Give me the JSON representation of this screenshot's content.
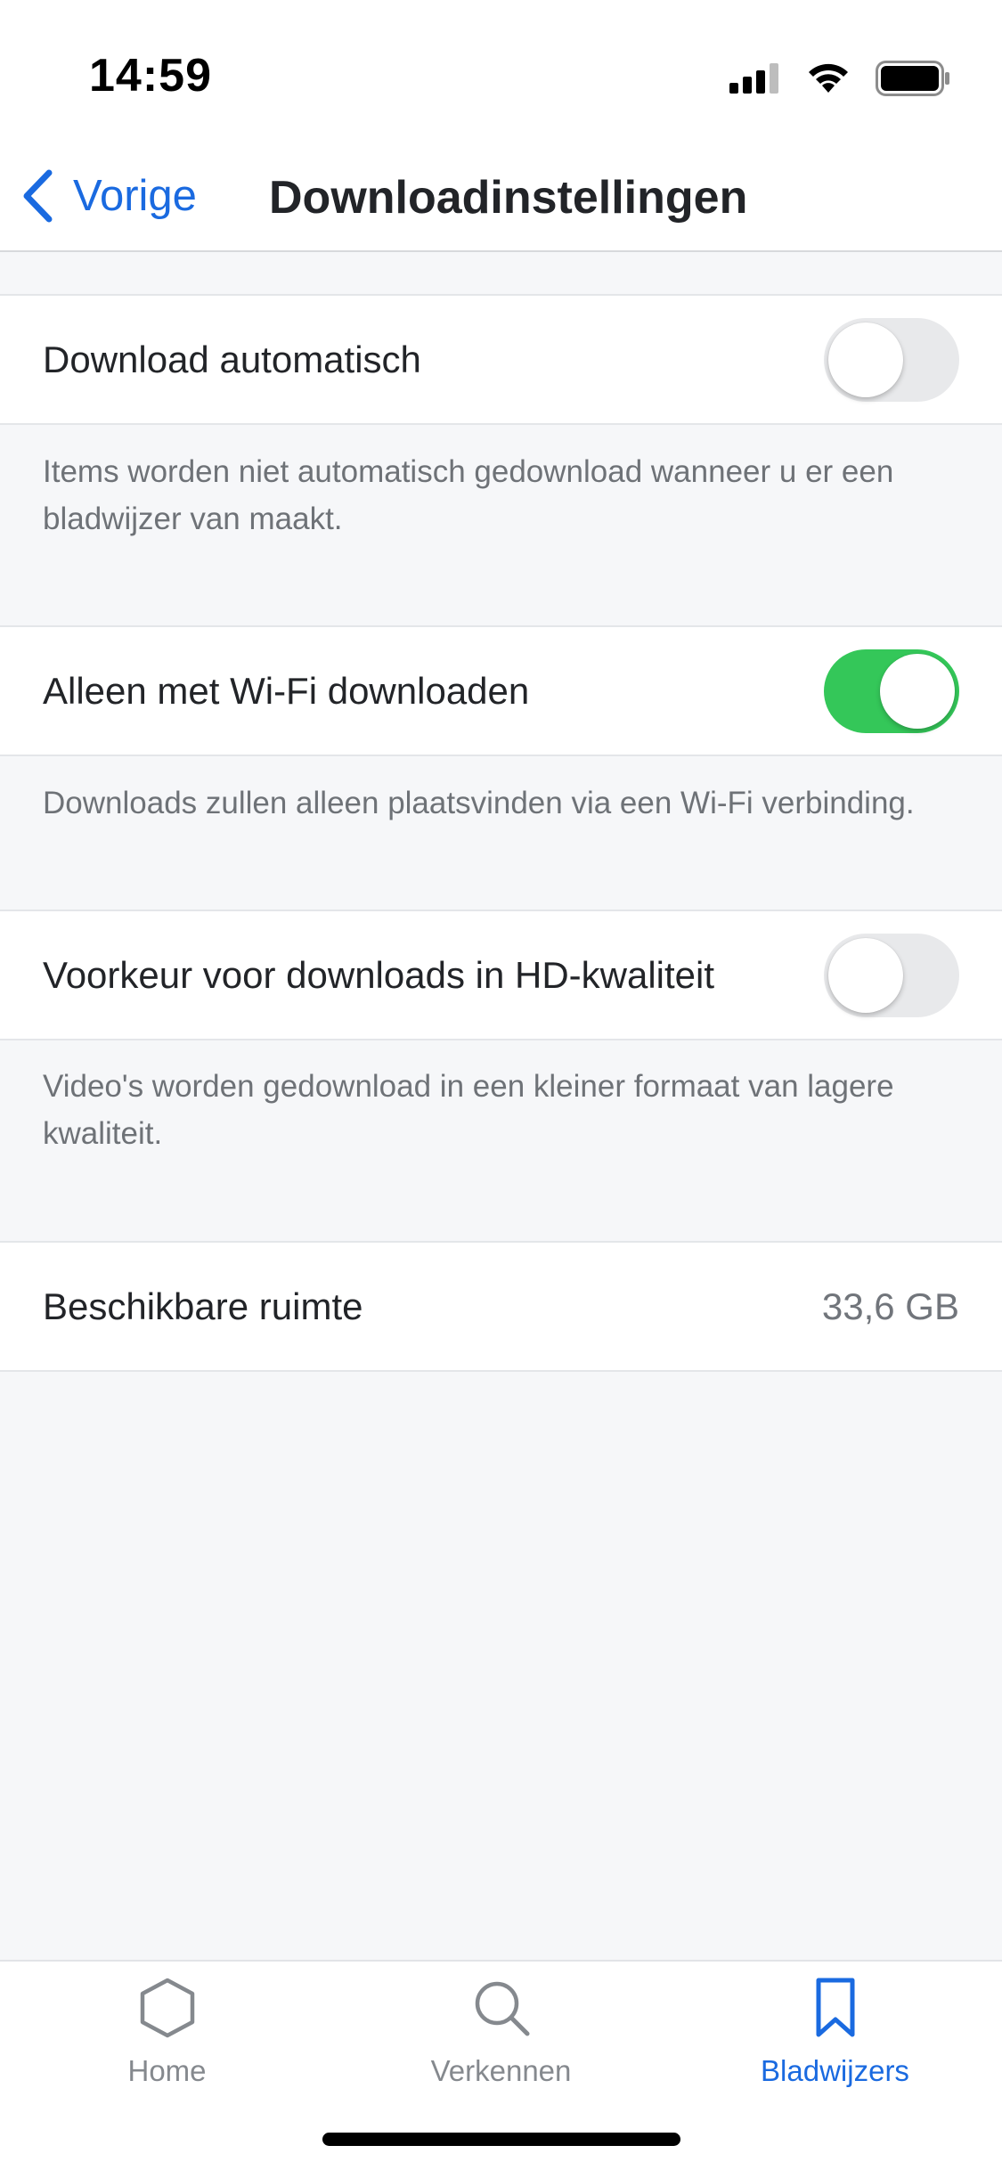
{
  "status_bar": {
    "time": "14:59"
  },
  "nav": {
    "back_label": "Vorige",
    "title": "Downloadinstellingen"
  },
  "settings": [
    {
      "label": "Download automatisch",
      "toggle_on": false,
      "description": "Items worden niet automatisch gedownload wanneer u er een bladwijzer van maakt."
    },
    {
      "label": "Alleen met Wi-Fi downloaden",
      "toggle_on": true,
      "description": "Downloads zullen alleen plaatsvinden via een Wi-Fi verbinding."
    },
    {
      "label": "Voorkeur voor downloads in HD-kwaliteit",
      "toggle_on": false,
      "description": "Video's worden gedownload in een kleiner formaat van lagere kwaliteit."
    }
  ],
  "storage": {
    "label": "Beschikbare ruimte",
    "value": "33,6 GB"
  },
  "tab_bar": {
    "items": [
      {
        "label": "Home",
        "icon": "hexagon-icon",
        "active": false
      },
      {
        "label": "Verkennen",
        "icon": "search-icon",
        "active": false
      },
      {
        "label": "Bladwijzers",
        "icon": "bookmark-icon",
        "active": true
      }
    ]
  },
  "colors": {
    "accent": "#1a6ae0",
    "toggle_on": "#34c759",
    "toggle_off": "#e8e9eb",
    "background": "#f6f7f9"
  }
}
